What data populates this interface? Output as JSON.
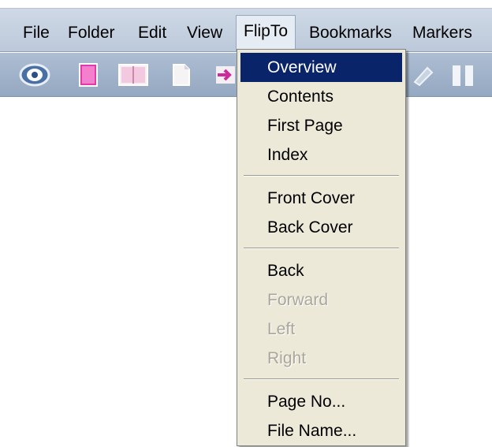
{
  "menubar": {
    "items": [
      {
        "label": "File"
      },
      {
        "label": "Folder"
      },
      {
        "label": "Edit"
      },
      {
        "label": "View"
      },
      {
        "label": "FlipTo"
      },
      {
        "label": "Bookmarks"
      },
      {
        "label": "Markers"
      }
    ]
  },
  "toolbar": {
    "icons": [
      "eye-icon",
      "pink-book-icon",
      "open-book-icon",
      "page-icon",
      "arrow-right-icon",
      "pen-icon",
      "pause-icon"
    ]
  },
  "dropdown": {
    "groups": [
      [
        {
          "label": "Overview",
          "highlighted": true
        },
        {
          "label": "Contents"
        },
        {
          "label": "First Page"
        },
        {
          "label": "Index"
        }
      ],
      [
        {
          "label": "Front Cover"
        },
        {
          "label": "Back Cover"
        }
      ],
      [
        {
          "label": "Back"
        },
        {
          "label": "Forward",
          "disabled": true
        },
        {
          "label": "Left",
          "disabled": true
        },
        {
          "label": "Right",
          "disabled": true
        }
      ],
      [
        {
          "label": "Page No..."
        },
        {
          "label": "File Name..."
        }
      ]
    ]
  },
  "colors": {
    "highlight": "#0a246a",
    "menu_bg": "#ece9d8",
    "disabled_text": "#a9a69b"
  }
}
